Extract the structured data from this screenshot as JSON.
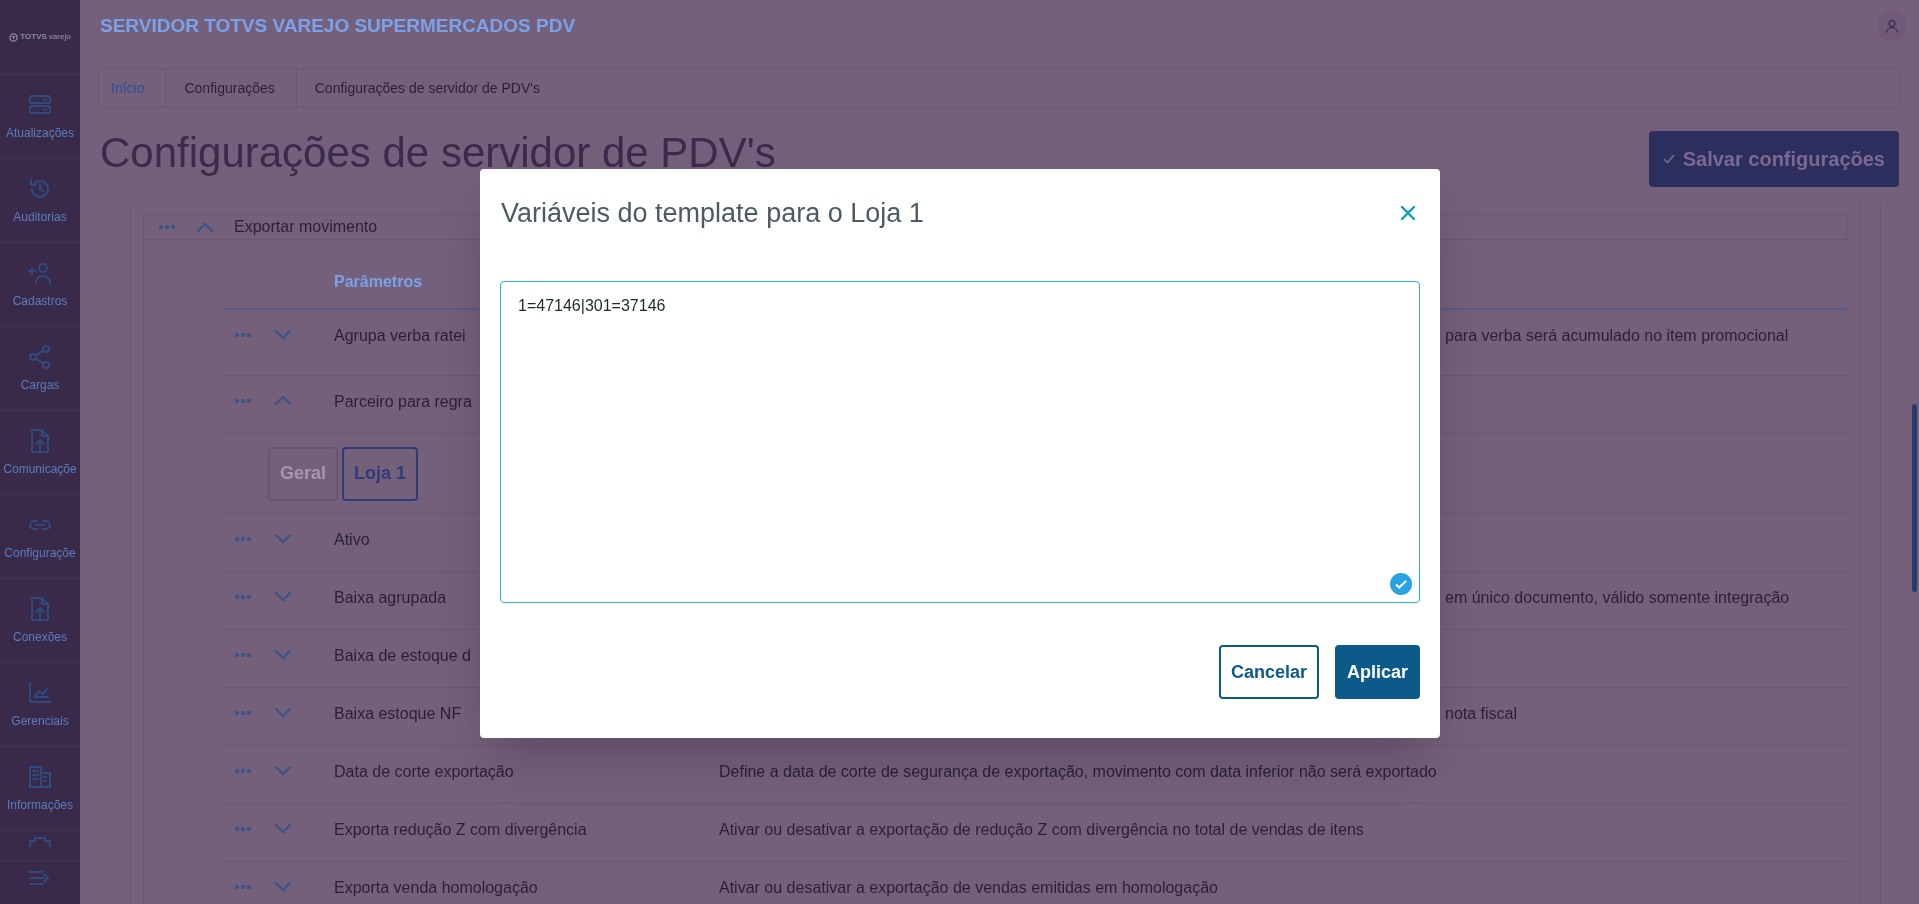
{
  "sidebar": {
    "logo": {
      "brand": "TOTVS",
      "sub": "varejo"
    },
    "items": [
      {
        "label": "Atualizações"
      },
      {
        "label": "Auditorias"
      },
      {
        "label": "Cadastros"
      },
      {
        "label": "Cargas"
      },
      {
        "label": "Comunicaçõe"
      },
      {
        "label": "Configuraçõe"
      },
      {
        "label": "Conexões"
      },
      {
        "label": "Gerenciais"
      },
      {
        "label": "Informações"
      }
    ]
  },
  "header": {
    "app_title": "SERVIDOR TOTVS VAREJO SUPERMERCADOS PDV"
  },
  "breadcrumb": [
    {
      "label": "Início",
      "link": true
    },
    {
      "label": "Configurações",
      "link": false
    },
    {
      "label": "Configurações de servidor de PDV's",
      "link": false
    }
  ],
  "page_title": "Configurações de servidor de PDV's",
  "save_button": "Salvar configurações",
  "section": {
    "title": "Exportar movimento",
    "expanded": true
  },
  "table": {
    "column": "Parâmetros",
    "rows": [
      {
        "kind": "param",
        "name": "Agrupa verba ratei",
        "expanded": false,
        "description": {
          "text": "para verba será acumulado no item promocional",
          "covered": true
        }
      },
      {
        "kind": "param",
        "name": "Parceiro para regra",
        "expanded": true
      },
      {
        "kind": "tabs",
        "tabs": [
          {
            "label": "Geral",
            "selected": false
          },
          {
            "label": "Loja 1",
            "selected": true
          }
        ]
      },
      {
        "kind": "param",
        "name": "Ativo",
        "expanded": false
      },
      {
        "kind": "param",
        "name": "Baixa agrupada",
        "expanded": false,
        "description": {
          "text": "em único documento, válido somente integração",
          "covered": true
        }
      },
      {
        "kind": "param",
        "name": "Baixa de estoque d",
        "expanded": false
      },
      {
        "kind": "param",
        "name": "Baixa estoque NF",
        "expanded": false,
        "description": {
          "text": "nota fiscal",
          "covered": true
        }
      },
      {
        "kind": "param",
        "name": "Data de corte exportação",
        "expanded": false,
        "description": {
          "text": "Define a data de corte de segurança de exportação, movimento com data inferior não será exportado",
          "covered": false
        }
      },
      {
        "kind": "param",
        "name": "Exporta redução Z com divergência",
        "expanded": false,
        "description": {
          "text": "Ativar ou desativar a exportação de redução Z com divergência no total de vendas de itens",
          "covered": false
        }
      },
      {
        "kind": "param",
        "name": "Exporta venda homologação",
        "expanded": false,
        "description": {
          "text": "Ativar ou desativar a exportação de vendas emitidas em homologação",
          "covered": false
        }
      }
    ]
  },
  "modal": {
    "title": "Variáveis do template para o Loja 1",
    "value": "1=47146|301=37146",
    "valid": true,
    "buttons": [
      {
        "label": "Cancelar",
        "kind": "secondary"
      },
      {
        "label": "Aplicar",
        "kind": "primary"
      }
    ]
  }
}
